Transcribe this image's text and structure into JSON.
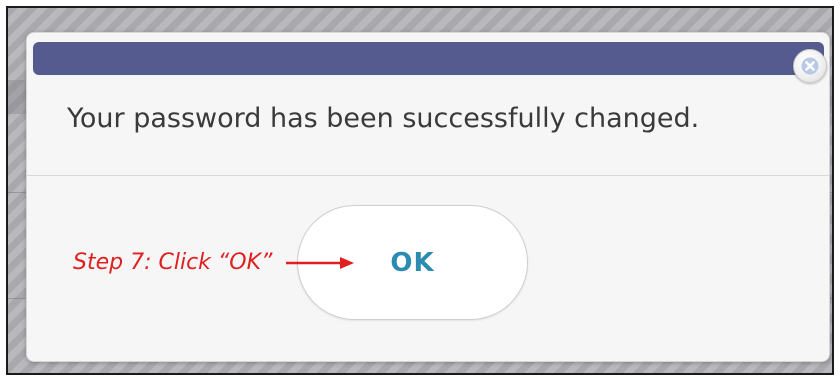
{
  "dialog": {
    "message": "Your password has been successfully changed.",
    "close_icon": "close-icon",
    "ok_label": "OK"
  },
  "annotation": {
    "text": "Step 7: Click “OK”",
    "color": "#e02020",
    "arrow_icon": "arrow-right-icon"
  },
  "colors": {
    "titlebar": "#565b8f",
    "ok_text": "#2c8bb0",
    "message_text": "#3a3a3a"
  }
}
